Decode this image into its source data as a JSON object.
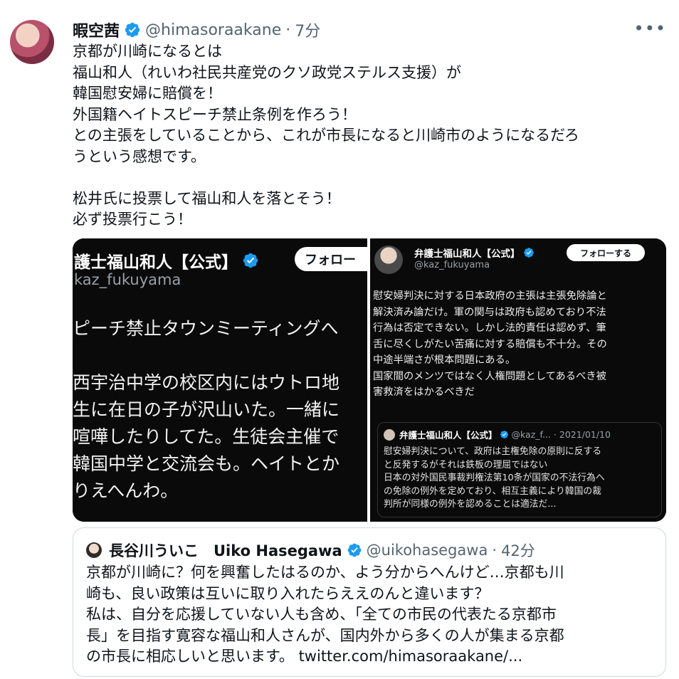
{
  "colors": {
    "verified_blue": "#1d9bf0",
    "text_secondary": "#536471",
    "media_bg": "#0a0a0a",
    "border": "#cfd9de"
  },
  "tweet": {
    "display_name": "暇空茜",
    "handle": "@himasoraakane",
    "separator": "·",
    "time": "7分",
    "more_icon": "•••",
    "text": "京都が川崎になるとは\n福山和人（れいわ社民共産党のクソ政党ステルス支援）が\n韓国慰安婦に賠償を！\n外国籍ヘイトスピーチ禁止条例を作ろう！\nとの主張をしていることから、これが市長になると川崎市のようになるだろ\nうという感想です。\n\n松井氏に投票して福山和人を落とそう！\n必ず投票行こう！"
  },
  "media_left": {
    "name": "護士福山和人【公式】",
    "follow_label": "フォロー",
    "handle": "kaz_fukuyama",
    "text": "ピーチ禁止タウンミーティングへ\n\n西宇治中学の校区内にはウトロ地\n生に在日の子が沢山いた。一緒に\n喧嘩したりしてた。生徒会主催で\n韓国中学と交流会も。ヘイトとか\nりえへんわ。"
  },
  "media_right": {
    "name": "弁護士福山和人【公式】",
    "follow_label": "フォローする",
    "handle": "@kaz_fukuyama",
    "text": "慰安婦判決に対する日本政府の主張は主張免除論と\n解決済み論だけ。軍の関与は政府も認めており不法\n行為は否定できない。しかし法的責任は認めず、筆\n舌に尽くしがたい苦痛に対する賠償も不十分。その\n中途半端さが根本問題にある。\n国家間のメンツではなく人権問題としてあるべき被\n害救済をはかるべきだ",
    "quoted": {
      "name": "弁護士福山和人【公式】",
      "handle": "@kaz_f...",
      "date": "· 2021/01/10",
      "text": "慰安婦判決について、政府は主権免除の原則に反する\nと反発するがそれは鉄板の理屈ではない\n日本の対外国民事裁判権法第10条が国家の不法行為へ\nの免除の例外を定めており、相互主義により韓国の裁\n判所が同様の例外を認めることは適法だ..."
    }
  },
  "quoted_tweet": {
    "display_name": "長谷川ういこ　Uiko Hasegawa",
    "handle": "@uikohasegawa",
    "separator": "·",
    "time": "42分",
    "text": "京都が川崎に？何を興奮したはるのか、よう分からへんけど…京都も川\n崎も、良い政策は互いに取り入れたらええのんと違います？\n私は、自分を応援していない人も含め、「全ての市民の代表たる京都市\n長」を目指す寛容な福山和人さんが、国内外から多くの人が集まる京都\nの市長に相応しいと思います。 ",
    "link": "twitter.com/himasoraakane/..."
  }
}
